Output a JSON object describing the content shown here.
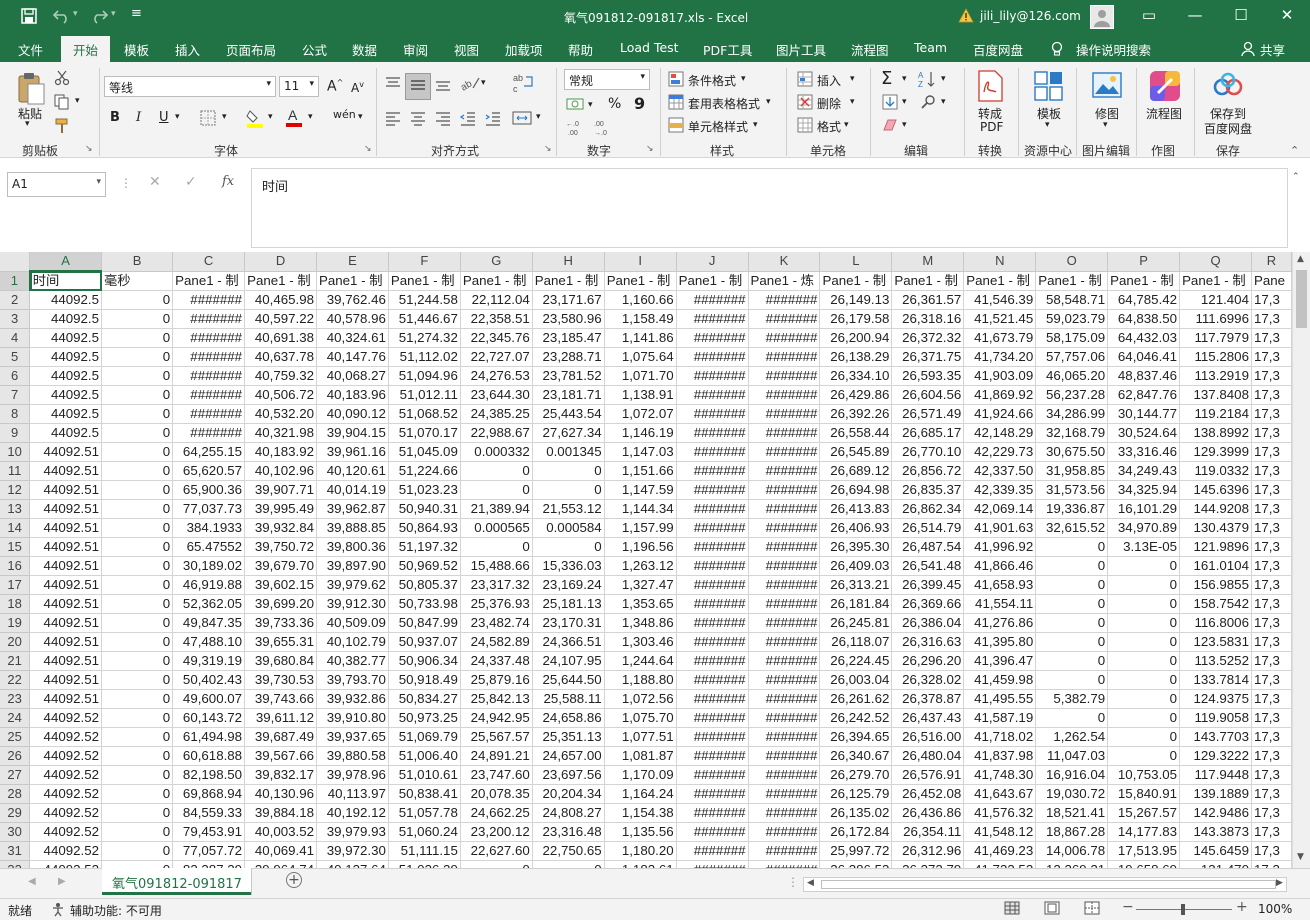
{
  "window": {
    "title": "氧气091812-091817.xls  -  Excel",
    "account": "jili_lily@126.com",
    "save_icon": "save-icon",
    "undo_icon": "undo-icon",
    "redo_icon": "redo-icon"
  },
  "menu": {
    "tabs": [
      "文件",
      "开始",
      "模板",
      "插入",
      "页面布局",
      "公式",
      "数据",
      "审阅",
      "视图",
      "加载项",
      "帮助",
      "Load Test",
      "PDF工具",
      "图片工具",
      "流程图",
      "Team",
      "百度网盘"
    ],
    "active": "开始",
    "search": "操作说明搜索",
    "share": "共享"
  },
  "ribbon": {
    "clipboard": {
      "paste": "粘贴",
      "label": "剪贴板"
    },
    "font": {
      "name": "等线",
      "size": "11",
      "bold": "B",
      "italic": "I",
      "underline": "U",
      "grow": "A",
      "shrink": "A",
      "phonetic": "wén",
      "label": "字体"
    },
    "alignment": {
      "label": "对齐方式"
    },
    "number": {
      "format": "常规",
      "percent": "%",
      "comma": "9",
      "label": "数字"
    },
    "styles": {
      "conditional": "条件格式",
      "table": "套用表格格式",
      "cell": "单元格样式",
      "label": "样式"
    },
    "cells": {
      "insert": "插入",
      "delete": "删除",
      "format": "格式",
      "label": "单元格"
    },
    "editing": {
      "label": "编辑"
    },
    "convert": {
      "btn": "转成",
      "btn2": "PDF",
      "label": "转换"
    },
    "template": {
      "btn": "模板",
      "label": "资源中心"
    },
    "image": {
      "btn": "修图",
      "label": "图片编辑"
    },
    "flow": {
      "btn": "流程图",
      "label": "作图"
    },
    "baidu": {
      "btn": "保存到",
      "btn2": "百度网盘",
      "label": "保存"
    }
  },
  "formula_bar": {
    "name_box": "A1",
    "content": "时间",
    "fx": "fx"
  },
  "sheet": {
    "columns": [
      "A",
      "B",
      "C",
      "D",
      "E",
      "F",
      "G",
      "H",
      "I",
      "J",
      "K",
      "L",
      "M",
      "N",
      "O",
      "P",
      "Q",
      "R"
    ],
    "header_row": [
      "时间",
      "毫秒",
      "Pane1 - 制",
      "Pane1 - 制",
      "Pane1 - 制",
      "Pane1 - 制",
      "Pane1 - 制",
      "Pane1 - 制",
      "Pane1 - 制",
      "Pane1 - 制",
      "Pane1 - 炼",
      "Pane1 - 制",
      "Pane1 - 制",
      "Pane1 - 制",
      "Pane1 - 制",
      "Pane1 - 制",
      "Pane1 - 制",
      "Pane"
    ],
    "rows": [
      [
        "44092.5",
        "0",
        "#######",
        "40,465.98",
        "39,762.46",
        "51,244.58",
        "22,112.04",
        "23,171.67",
        "1,160.66",
        "#######",
        "#######",
        "26,149.13",
        "26,361.57",
        "41,546.39",
        "58,548.71",
        "64,785.42",
        "121.404",
        "17,3"
      ],
      [
        "44092.5",
        "0",
        "#######",
        "40,597.22",
        "40,578.96",
        "51,446.67",
        "22,358.51",
        "23,580.96",
        "1,158.49",
        "#######",
        "#######",
        "26,179.58",
        "26,318.16",
        "41,521.45",
        "59,023.79",
        "64,838.50",
        "111.6996",
        "17,3"
      ],
      [
        "44092.5",
        "0",
        "#######",
        "40,691.38",
        "40,324.61",
        "51,274.32",
        "22,345.76",
        "23,185.47",
        "1,141.86",
        "#######",
        "#######",
        "26,200.94",
        "26,372.32",
        "41,673.79",
        "58,175.09",
        "64,432.03",
        "117.7979",
        "17,3"
      ],
      [
        "44092.5",
        "0",
        "#######",
        "40,637.78",
        "40,147.76",
        "51,112.02",
        "22,727.07",
        "23,288.71",
        "1,075.64",
        "#######",
        "#######",
        "26,138.29",
        "26,371.75",
        "41,734.20",
        "57,757.06",
        "64,046.41",
        "115.2806",
        "17,3"
      ],
      [
        "44092.5",
        "0",
        "#######",
        "40,759.32",
        "40,068.27",
        "51,094.96",
        "24,276.53",
        "23,781.52",
        "1,071.70",
        "#######",
        "#######",
        "26,334.10",
        "26,593.35",
        "41,903.09",
        "46,065.20",
        "48,837.46",
        "113.2919",
        "17,3"
      ],
      [
        "44092.5",
        "0",
        "#######",
        "40,506.72",
        "40,183.96",
        "51,012.11",
        "23,644.30",
        "23,181.71",
        "1,138.91",
        "#######",
        "#######",
        "26,429.86",
        "26,604.56",
        "41,869.92",
        "56,237.28",
        "62,847.76",
        "137.8408",
        "17,3"
      ],
      [
        "44092.5",
        "0",
        "#######",
        "40,532.20",
        "40,090.12",
        "51,068.52",
        "24,385.25",
        "25,443.54",
        "1,072.07",
        "#######",
        "#######",
        "26,392.26",
        "26,571.49",
        "41,924.66",
        "34,286.99",
        "30,144.77",
        "119.2184",
        "17,3"
      ],
      [
        "44092.5",
        "0",
        "#######",
        "40,321.98",
        "39,904.15",
        "51,070.17",
        "22,988.67",
        "27,627.34",
        "1,146.19",
        "#######",
        "#######",
        "26,558.44",
        "26,685.17",
        "42,148.29",
        "32,168.79",
        "30,524.64",
        "138.8992",
        "17,3"
      ],
      [
        "44092.51",
        "0",
        "64,255.15",
        "40,183.92",
        "39,961.16",
        "51,045.09",
        "0.000332",
        "0.001345",
        "1,147.03",
        "#######",
        "#######",
        "26,545.89",
        "26,770.10",
        "42,229.73",
        "30,675.50",
        "33,316.46",
        "129.3999",
        "17,3"
      ],
      [
        "44092.51",
        "0",
        "65,620.57",
        "40,102.96",
        "40,120.61",
        "51,224.66",
        "0",
        "0",
        "1,151.66",
        "#######",
        "#######",
        "26,689.12",
        "26,856.72",
        "42,337.50",
        "31,958.85",
        "34,249.43",
        "119.0332",
        "17,3"
      ],
      [
        "44092.51",
        "0",
        "65,900.36",
        "39,907.71",
        "40,014.19",
        "51,023.23",
        "0",
        "0",
        "1,147.59",
        "#######",
        "#######",
        "26,694.98",
        "26,835.37",
        "42,339.35",
        "31,573.56",
        "34,325.94",
        "145.6396",
        "17,3"
      ],
      [
        "44092.51",
        "0",
        "77,037.73",
        "39,995.49",
        "39,962.87",
        "50,940.31",
        "21,389.94",
        "21,553.12",
        "1,144.34",
        "#######",
        "#######",
        "26,413.83",
        "26,862.34",
        "42,069.14",
        "19,336.87",
        "16,101.29",
        "144.9208",
        "17,3"
      ],
      [
        "44092.51",
        "0",
        "384.1933",
        "39,932.84",
        "39,888.85",
        "50,864.93",
        "0.000565",
        "0.000584",
        "1,157.99",
        "#######",
        "#######",
        "26,406.93",
        "26,514.79",
        "41,901.63",
        "32,615.52",
        "34,970.89",
        "130.4379",
        "17,3"
      ],
      [
        "44092.51",
        "0",
        "65.47552",
        "39,750.72",
        "39,800.36",
        "51,197.32",
        "0",
        "0",
        "1,196.56",
        "#######",
        "#######",
        "26,395.30",
        "26,487.54",
        "41,996.92",
        "0",
        "3.13E-05",
        "121.9896",
        "17,3"
      ],
      [
        "44092.51",
        "0",
        "30,189.02",
        "39,679.70",
        "39,897.90",
        "50,969.52",
        "15,488.66",
        "15,336.03",
        "1,263.12",
        "#######",
        "#######",
        "26,409.03",
        "26,541.48",
        "41,866.46",
        "0",
        "0",
        "161.0104",
        "17,3"
      ],
      [
        "44092.51",
        "0",
        "46,919.88",
        "39,602.15",
        "39,979.62",
        "50,805.37",
        "23,317.32",
        "23,169.24",
        "1,327.47",
        "#######",
        "#######",
        "26,313.21",
        "26,399.45",
        "41,658.93",
        "0",
        "0",
        "156.9855",
        "17,3"
      ],
      [
        "44092.51",
        "0",
        "52,362.05",
        "39,699.20",
        "39,912.30",
        "50,733.98",
        "25,376.93",
        "25,181.13",
        "1,353.65",
        "#######",
        "#######",
        "26,181.84",
        "26,369.66",
        "41,554.11",
        "0",
        "0",
        "158.7542",
        "17,3"
      ],
      [
        "44092.51",
        "0",
        "49,847.35",
        "39,733.36",
        "40,509.09",
        "50,847.99",
        "23,482.74",
        "23,170.31",
        "1,348.86",
        "#######",
        "#######",
        "26,245.81",
        "26,386.04",
        "41,276.86",
        "0",
        "0",
        "116.8006",
        "17,3"
      ],
      [
        "44092.51",
        "0",
        "47,488.10",
        "39,655.31",
        "40,102.79",
        "50,937.07",
        "24,582.89",
        "24,366.51",
        "1,303.46",
        "#######",
        "#######",
        "26,118.07",
        "26,316.63",
        "41,395.80",
        "0",
        "0",
        "123.5831",
        "17,3"
      ],
      [
        "44092.51",
        "0",
        "49,319.19",
        "39,680.84",
        "40,382.77",
        "50,906.34",
        "24,337.48",
        "24,107.95",
        "1,244.64",
        "#######",
        "#######",
        "26,224.45",
        "26,296.20",
        "41,396.47",
        "0",
        "0",
        "113.5252",
        "17,3"
      ],
      [
        "44092.51",
        "0",
        "50,402.43",
        "39,730.53",
        "39,793.70",
        "50,918.49",
        "25,879.16",
        "25,644.50",
        "1,188.80",
        "#######",
        "#######",
        "26,003.04",
        "26,328.02",
        "41,459.98",
        "0",
        "0",
        "133.7814",
        "17,3"
      ],
      [
        "44092.51",
        "0",
        "49,600.07",
        "39,743.66",
        "39,932.86",
        "50,834.27",
        "25,842.13",
        "25,588.11",
        "1,072.56",
        "#######",
        "#######",
        "26,261.62",
        "26,378.87",
        "41,495.55",
        "5,382.79",
        "0",
        "124.9375",
        "17,3"
      ],
      [
        "44092.52",
        "0",
        "60,143.72",
        "39,611.12",
        "39,910.80",
        "50,973.25",
        "24,942.95",
        "24,658.86",
        "1,075.70",
        "#######",
        "#######",
        "26,242.52",
        "26,437.43",
        "41,587.19",
        "0",
        "0",
        "119.9058",
        "17,3"
      ],
      [
        "44092.52",
        "0",
        "61,494.98",
        "39,687.49",
        "39,937.65",
        "51,069.79",
        "25,567.57",
        "25,351.13",
        "1,077.51",
        "#######",
        "#######",
        "26,394.65",
        "26,516.00",
        "41,718.02",
        "1,262.54",
        "0",
        "143.7703",
        "17,3"
      ],
      [
        "44092.52",
        "0",
        "60,618.88",
        "39,567.66",
        "39,880.58",
        "51,006.40",
        "24,891.21",
        "24,657.00",
        "1,081.87",
        "#######",
        "#######",
        "26,340.67",
        "26,480.04",
        "41,837.98",
        "11,047.03",
        "0",
        "129.3222",
        "17,3"
      ],
      [
        "44092.52",
        "0",
        "82,198.50",
        "39,832.17",
        "39,978.96",
        "51,010.61",
        "23,747.60",
        "23,697.56",
        "1,170.09",
        "#######",
        "#######",
        "26,279.70",
        "26,576.91",
        "41,748.30",
        "16,916.04",
        "10,753.05",
        "117.9448",
        "17,3"
      ],
      [
        "44092.52",
        "0",
        "69,868.94",
        "40,130.96",
        "40,113.97",
        "50,838.41",
        "20,078.35",
        "20,204.34",
        "1,164.24",
        "#######",
        "#######",
        "26,125.79",
        "26,452.08",
        "41,643.67",
        "19,030.72",
        "15,840.91",
        "139.1889",
        "17,3"
      ],
      [
        "44092.52",
        "0",
        "84,559.33",
        "39,884.18",
        "40,192.12",
        "51,057.78",
        "24,662.25",
        "24,808.27",
        "1,154.38",
        "#######",
        "#######",
        "26,135.02",
        "26,436.86",
        "41,576.32",
        "18,521.41",
        "15,267.57",
        "142.9486",
        "17,3"
      ],
      [
        "44092.52",
        "0",
        "79,453.91",
        "40,003.52",
        "39,979.93",
        "51,060.24",
        "23,200.12",
        "23,316.48",
        "1,135.56",
        "#######",
        "#######",
        "26,172.84",
        "26,354.11",
        "41,548.12",
        "18,867.28",
        "14,177.83",
        "143.3873",
        "17,3"
      ],
      [
        "44092.52",
        "0",
        "77,057.72",
        "40,069.41",
        "39,972.30",
        "51,111.15",
        "22,627.60",
        "22,750.65",
        "1,180.20",
        "#######",
        "#######",
        "25,997.72",
        "26,312.96",
        "41,469.23",
        "14,006.78",
        "17,513.95",
        "145.6459",
        "17,3"
      ],
      [
        "44092.52",
        "0",
        "83,387.29",
        "39,964.74",
        "40,137.64",
        "51,036.29",
        "0",
        "0",
        "1,182.61",
        "#######",
        "#######",
        "26,286.53",
        "26,372.79",
        "41,733.52",
        "12,369.21",
        "19,658.69",
        "131.470",
        "17,3"
      ]
    ]
  },
  "sheet_tab": {
    "name": "氧气091812-091817",
    "add": "+"
  },
  "status": {
    "ready": "就绪",
    "accessibility": "辅助功能: 不可用",
    "zoom": "100%"
  }
}
